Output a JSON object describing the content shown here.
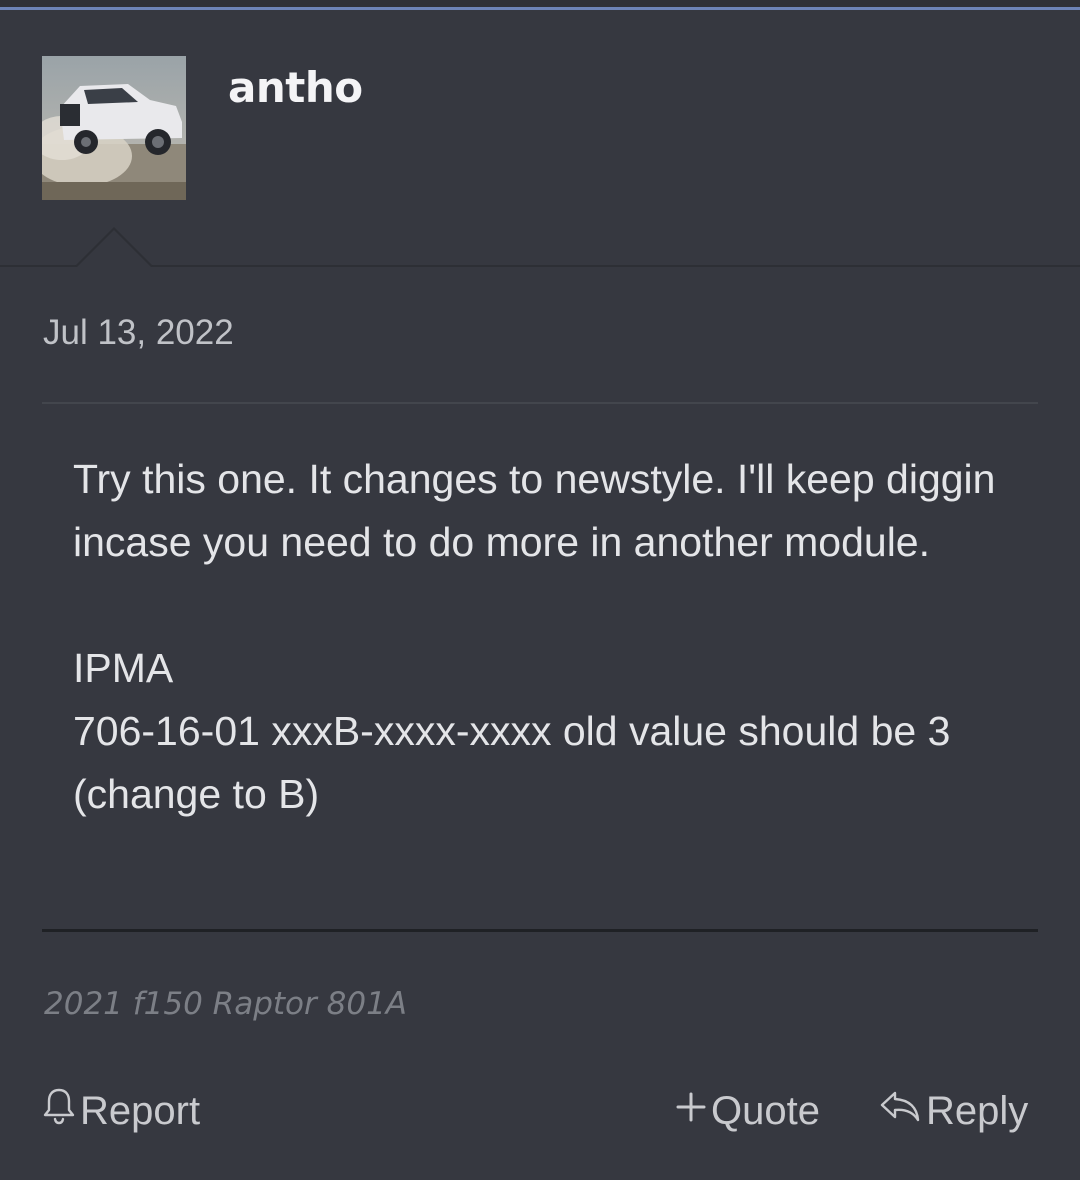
{
  "user": {
    "name": "antho",
    "avatar_alt": "avatar"
  },
  "post": {
    "date": "Jul 13, 2022",
    "body": [
      "Try this one. It changes to newstyle. I'll keep diggin incase you need to do more in another module.",
      "IPMA",
      "706-16-01 xxxB-xxxx-xxxx old value should be 3 (change to B)"
    ],
    "signature": "2021 f150 Raptor 801A"
  },
  "actions": {
    "report_label": "Report",
    "quote_label": "Quote",
    "reply_label": "Reply",
    "report_icon": "bell-icon",
    "quote_icon": "plus-icon",
    "reply_icon": "reply-arrow-icon"
  },
  "colors": {
    "background": "#363840",
    "accent_border": "#6d84b8",
    "text": "#e4e5e8",
    "muted_text": "#7c7f86"
  }
}
